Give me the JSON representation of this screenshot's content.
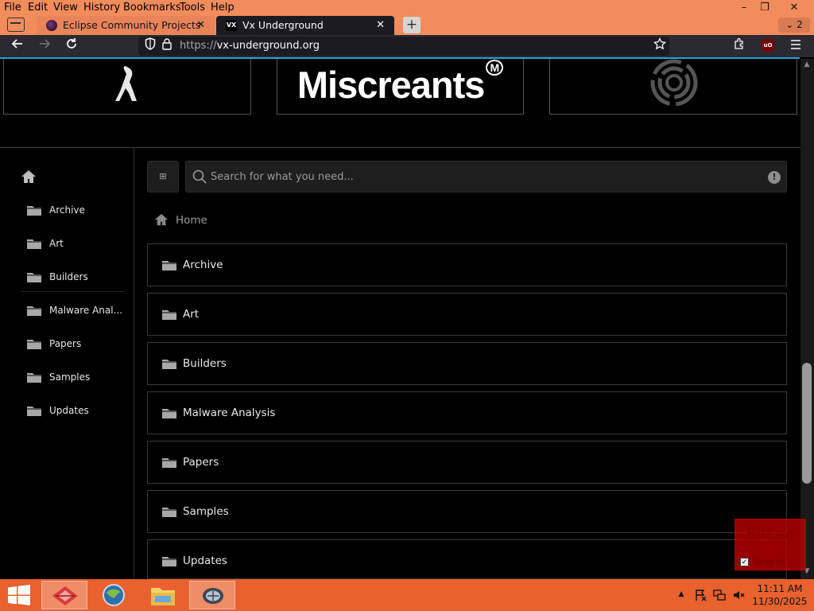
{
  "menubar": {
    "items": [
      "File",
      "Edit",
      "View",
      "History",
      "Bookmarks",
      "Tools",
      "Help"
    ],
    "window_controls": {
      "minimize": "–",
      "restore": "❐",
      "close": "✕"
    }
  },
  "tabs": [
    {
      "title": "Eclipse Community Projects",
      "close": "✕"
    },
    {
      "title": "Vx Underground",
      "favicon_text": "VX",
      "close": "✕"
    }
  ],
  "tab_count": "⌄ 2",
  "newtab_label": "+",
  "navbar": {
    "url_proto": "https://",
    "url_host": "vx-underground.org",
    "ublock_label": "uO"
  },
  "page": {
    "logos": [
      "",
      "Miscreants",
      ""
    ],
    "logo_mark": "M",
    "search": {
      "toggle_label": "⊞",
      "placeholder": "Search for what you need...",
      "info": "!"
    },
    "breadcrumb": "Home",
    "sidebar": [
      "Archive",
      "Art",
      "Builders",
      "Malware Anal...",
      "Papers",
      "Samples",
      "Updates"
    ],
    "folders": [
      "Archive",
      "Art",
      "Builders",
      "Malware Analysis",
      "Papers",
      "Samples",
      "Updates"
    ]
  },
  "overlay": {
    "enter_label": "Enter",
    "snap_label": "Snap to",
    "snap_check": "✓"
  },
  "taskbar": {
    "time": "11:11 AM",
    "date": "11/30/2025",
    "tray": {
      "up": "▲"
    }
  },
  "colors": {
    "accent": "#2e9bd6",
    "taskbar": "#e8612e",
    "menubar": "#f28c5c"
  }
}
